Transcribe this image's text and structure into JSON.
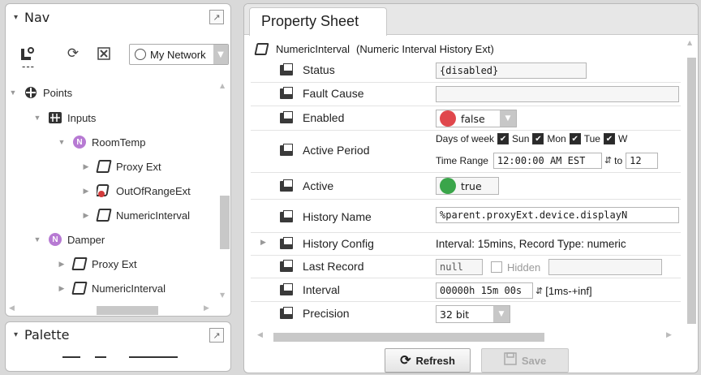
{
  "nav": {
    "title": "Nav",
    "network_select": "My Network",
    "toolbar_dashes": "---",
    "tree": [
      {
        "label": "Points",
        "icon": "points-icon",
        "expanded": true
      },
      {
        "label": "Inputs",
        "icon": "folder-grid-icon",
        "expanded": true
      },
      {
        "label": "RoomTemp",
        "icon": "numeric-point-icon",
        "expanded": true
      },
      {
        "label": "Proxy Ext",
        "icon": "extension-icon",
        "expanded": false
      },
      {
        "label": "OutOfRangeExt",
        "icon": "alarm-extension-icon",
        "expanded": false
      },
      {
        "label": "NumericInterval",
        "icon": "extension-icon",
        "expanded": false
      },
      {
        "label": "Damper",
        "icon": "numeric-point-icon",
        "expanded": true
      },
      {
        "label": "Proxy Ext",
        "icon": "extension-icon",
        "expanded": false
      },
      {
        "label": "NumericInterval",
        "icon": "extension-icon",
        "expanded": false
      }
    ]
  },
  "palette": {
    "title": "Palette"
  },
  "property_sheet": {
    "tab_label": "Property Sheet",
    "component_name": "NumericInterval",
    "component_type": "(Numeric Interval History Ext)",
    "rows": {
      "status": {
        "label": "Status",
        "value": "{disabled}"
      },
      "fault_cause": {
        "label": "Fault Cause",
        "value": ""
      },
      "enabled": {
        "label": "Enabled",
        "value": "false",
        "color": "#e0474c"
      },
      "active_period": {
        "label": "Active Period",
        "days_label": "Days of week",
        "days": [
          "Sun",
          "Mon",
          "Tue",
          "W"
        ],
        "time_range_label": "Time Range",
        "time_from": "12:00:00 AM EST",
        "to_label": "to",
        "time_to": "12"
      },
      "active": {
        "label": "Active",
        "value": "true",
        "color": "#3aa54a"
      },
      "history_name": {
        "label": "History Name",
        "value": "%parent.proxyExt.device.displayN"
      },
      "history_config": {
        "label": "History Config",
        "value": "Interval: 15mins, Record Type: numeric"
      },
      "last_record": {
        "label": "Last Record",
        "value": "null",
        "hidden_label": "Hidden"
      },
      "interval": {
        "label": "Interval",
        "value": "00000h 15m 00s",
        "range": "[1ms-+inf]"
      },
      "precision": {
        "label": "Precision",
        "value": "32 bit"
      }
    },
    "buttons": {
      "refresh": "Refresh",
      "save": "Save"
    }
  }
}
